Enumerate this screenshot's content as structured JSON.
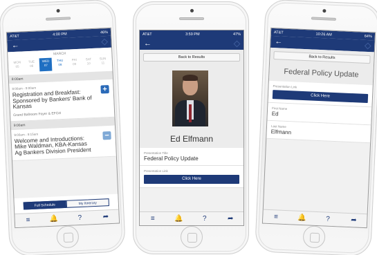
{
  "phone1": {
    "status": {
      "carrier": "AT&T",
      "time": "4:00 PM",
      "battery": "46%"
    },
    "nav": {
      "back": "←"
    },
    "calendar": {
      "month": "MARCH",
      "days": [
        {
          "dow": "MON",
          "date": "05"
        },
        {
          "dow": "TUE",
          "date": "06"
        },
        {
          "dow": "WED",
          "date": "07"
        },
        {
          "dow": "THU",
          "date": "08"
        },
        {
          "dow": "FRI",
          "date": "09"
        },
        {
          "dow": "SAT",
          "date": "10"
        },
        {
          "dow": "SUN",
          "date": "11"
        }
      ]
    },
    "sections": [
      {
        "time": "8:00am",
        "session": {
          "range": "8:00am - 9:00am",
          "title": "Registration and Breakfast: Sponsored by Bankers' Bank of Kansas",
          "location": "Grand Ballroom Foyer & EFGH",
          "action": "+"
        }
      },
      {
        "time": "9:00am",
        "session": {
          "range": "9:00am - 9:15am",
          "title": "Welcome and Introductions: Mike Waldman, KBA-Kansas Ag Bankers Division President",
          "location": "",
          "action": "−"
        }
      }
    ],
    "segment": {
      "full": "Full Schedule",
      "mine": "My Itinerary"
    }
  },
  "phone2": {
    "status": {
      "carrier": "AT&T",
      "time": "3:59 PM",
      "battery": "47%"
    },
    "back_to_results": "Back to Results",
    "speaker_name": "Ed Elfmann",
    "presentation_title_label": "Presentation Title",
    "presentation_title": "Federal Policy Update",
    "presentation_link_label": "Presentation Link",
    "click_here": "Click Here"
  },
  "phone3": {
    "status": {
      "carrier": "AT&T",
      "time": "10:26 AM",
      "battery": "64%"
    },
    "back_to_results": "Back to Results",
    "title": "Federal Policy Update",
    "presentation_link_label": "Presentation Link",
    "click_here": "Click Here",
    "first_name_label": "First Name",
    "first_name": "Ed",
    "last_name_label": "Last Name",
    "last_name": "Elfmann"
  },
  "tabbar": {
    "menu": "≡",
    "alerts": "🔔",
    "help": "?",
    "share": "➦"
  },
  "colors": {
    "navy": "#1e3a78",
    "selected_day": "#1f6fc2",
    "add_button": "#2a6ab8",
    "remove_button": "#7fa9d6"
  }
}
